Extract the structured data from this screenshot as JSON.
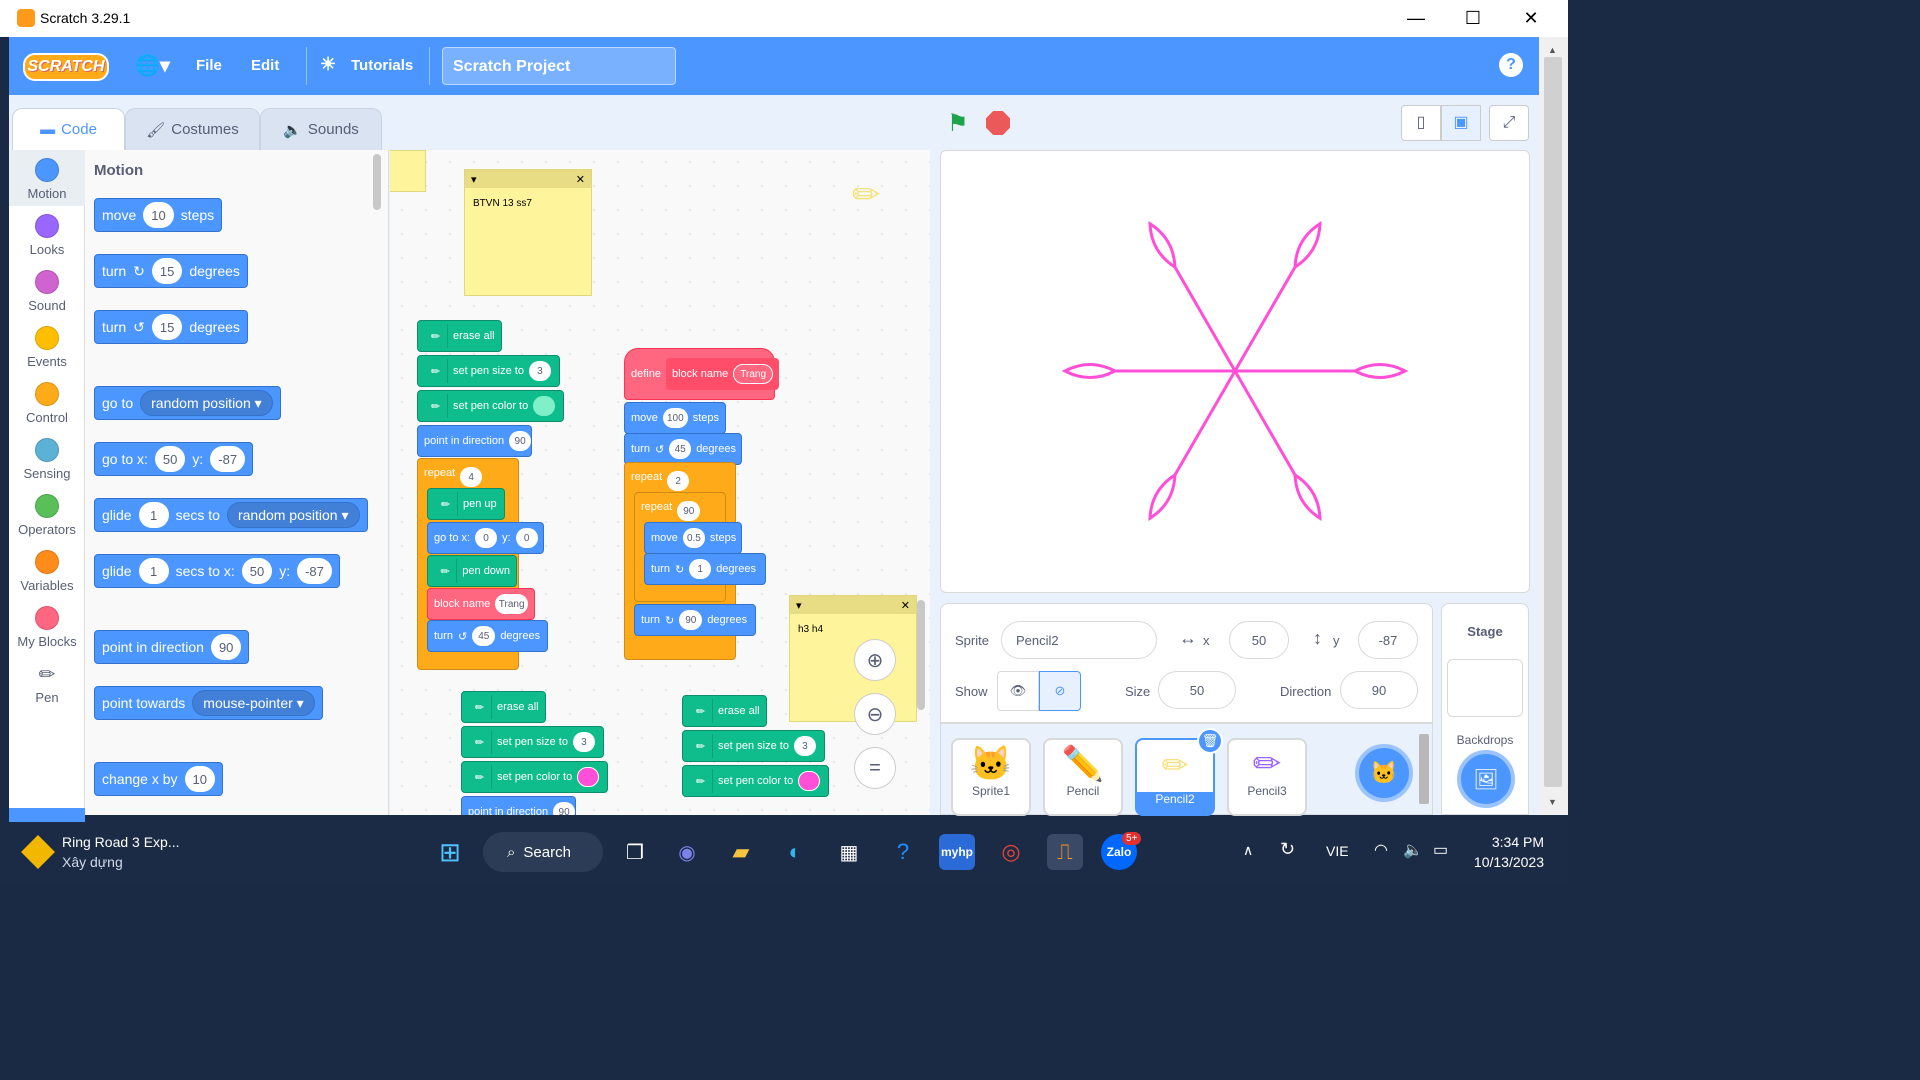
{
  "window": {
    "title": "Scratch 3.29.1"
  },
  "menubar": {
    "logo": "SCRATCH",
    "file": "File",
    "edit": "Edit",
    "tutorials": "Tutorials",
    "project_name": "Scratch Project"
  },
  "tabs": [
    {
      "label": "Code",
      "active": true
    },
    {
      "label": "Costumes",
      "active": false
    },
    {
      "label": "Sounds",
      "active": false
    }
  ],
  "categories": [
    {
      "label": "Motion",
      "color": "#4c97ff"
    },
    {
      "label": "Looks",
      "color": "#9966ff"
    },
    {
      "label": "Sound",
      "color": "#cf63cf"
    },
    {
      "label": "Events",
      "color": "#ffbf00"
    },
    {
      "label": "Control",
      "color": "#ffab19"
    },
    {
      "label": "Sensing",
      "color": "#5cb1d6"
    },
    {
      "label": "Operators",
      "color": "#59c059"
    },
    {
      "label": "Variables",
      "color": "#ff8c1a"
    },
    {
      "label": "My Blocks",
      "color": "#ff6680"
    },
    {
      "label": "Pen",
      "color": "#0fbd8c"
    }
  ],
  "palette": {
    "heading": "Motion",
    "move": {
      "a": "move",
      "v": "10",
      "b": "steps"
    },
    "turn_right": {
      "a": "turn",
      "v": "15",
      "b": "degrees"
    },
    "turn_left": {
      "a": "turn",
      "v": "15",
      "b": "degrees"
    },
    "goto": {
      "a": "go to",
      "dd": "random position"
    },
    "gotoxy": {
      "a": "go to x:",
      "x": "50",
      "b": "y:",
      "y": "-87"
    },
    "glide": {
      "a": "glide",
      "v": "1",
      "b": "secs to",
      "dd": "random position"
    },
    "glidexy": {
      "a": "glide",
      "v": "1",
      "b": "secs to x:",
      "x": "50",
      "c": "y:",
      "y": "-87"
    },
    "point": {
      "a": "point in direction",
      "v": "90"
    },
    "towards": {
      "a": "point towards",
      "dd": "mouse-pointer"
    },
    "changex": {
      "a": "change x by",
      "v": "10"
    }
  },
  "notes": [
    {
      "text": "BTVN 13 ss7"
    },
    {
      "text": "h3 h4"
    }
  ],
  "script1": {
    "erase": "erase all",
    "size": "set pen size to",
    "size_v": "3",
    "color": "set pen color to",
    "dir": "point in direction",
    "dir_v": "90",
    "repeat": "repeat",
    "repeat_v": "4",
    "penup": "pen up",
    "goto": "go to x:",
    "gx": "0",
    "gy_label": "y:",
    "gy": "0",
    "pendown": "pen down",
    "block": "block name",
    "block_arg": "Trang",
    "turn": "turn",
    "turn_v": "45",
    "turn_b": "degrees"
  },
  "script2": {
    "define": "define",
    "name": "block name",
    "arg": "Trang",
    "move": "move",
    "move_v": "100",
    "move_b": "steps",
    "turn": "turn",
    "turn_v": "45",
    "turn_b": "degrees",
    "repeat": "repeat",
    "repeat_v": "2",
    "repeat2": "repeat",
    "repeat2_v": "90",
    "move2": "move",
    "move2_v": "0.5",
    "move2_b": "steps",
    "turn2": "turn",
    "turn2_v": "1",
    "turn2_b": "degrees",
    "turn3": "turn",
    "turn3_v": "90",
    "turn3_b": "degrees"
  },
  "script3": {
    "erase": "erase all",
    "size": "set pen size to",
    "size_v": "3",
    "color": "set pen color to",
    "dir": "point in direction",
    "dir_v": "90"
  },
  "script4": {
    "erase": "erase all",
    "size": "set pen size to",
    "size_v": "3",
    "color": "set pen color to"
  },
  "sprite_info": {
    "sprite_label": "Sprite",
    "sprite_name": "Pencil2",
    "x_label": "x",
    "x": "50",
    "y_label": "y",
    "y": "-87",
    "show_label": "Show",
    "size_label": "Size",
    "size": "50",
    "direction_label": "Direction",
    "direction": "90"
  },
  "sprites": [
    {
      "name": "Sprite1",
      "selected": false
    },
    {
      "name": "Pencil",
      "selected": false
    },
    {
      "name": "Pencil2",
      "selected": true
    },
    {
      "name": "Pencil3",
      "selected": false
    }
  ],
  "stage_panel": {
    "title": "Stage",
    "backdrops": "Backdrops"
  },
  "drawing_color": "#ff4fd8",
  "taskbar": {
    "news_title": "Ring Road 3 Exp...",
    "news_sub": "Xây dựng",
    "search": "Search",
    "lang": "VIE",
    "time": "3:34 PM",
    "date": "10/13/2023",
    "zalo_badge": "5+"
  }
}
